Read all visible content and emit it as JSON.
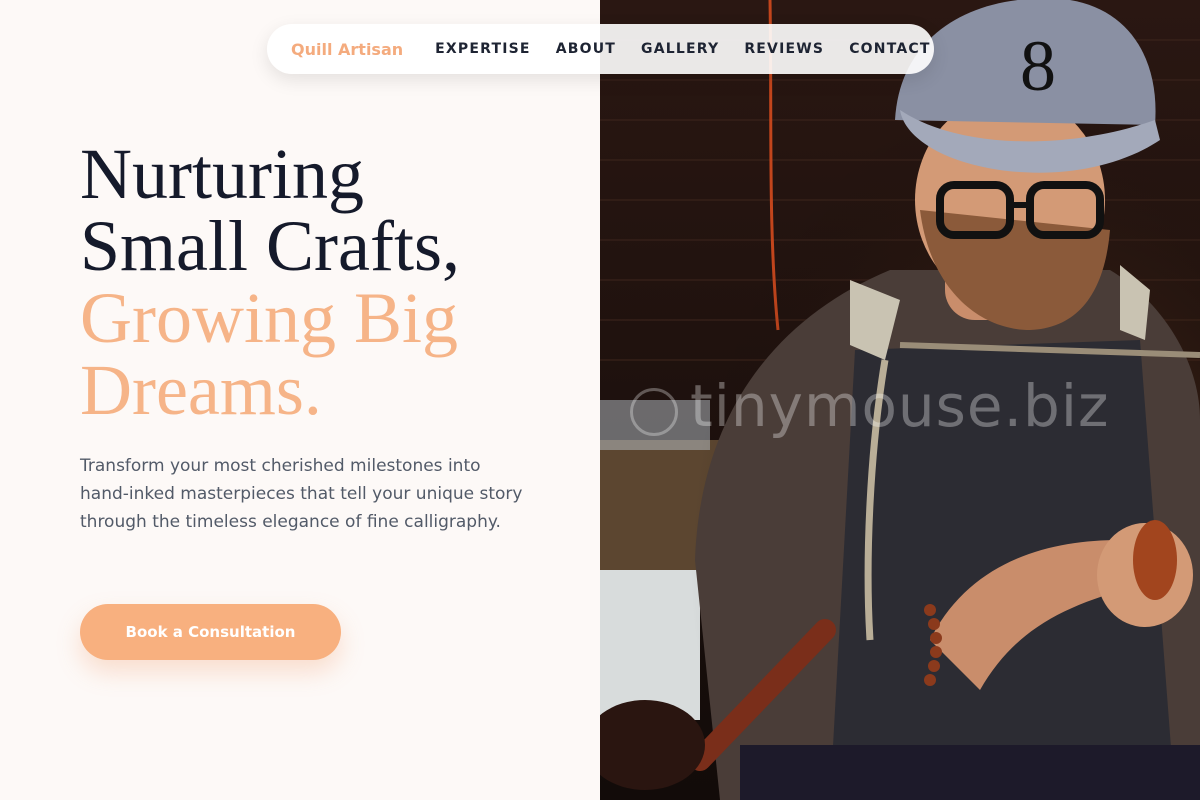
{
  "nav": {
    "brand": "Quill Artisan",
    "links": [
      "EXPERTISE",
      "ABOUT",
      "GALLERY",
      "REVIEWS",
      "CONTACT"
    ]
  },
  "hero": {
    "title_lines": [
      "Nurturing",
      "Small Crafts,"
    ],
    "accent_lines": [
      "Growing Big",
      "Dreams."
    ],
    "description": "Transform your most cherished milestones into hand-inked masterpieces that tell your unique story through the timeless elegance of fine calligraphy.",
    "cta_label": "Book a Consultation"
  },
  "photo": {
    "watermark": "tinymouse.biz"
  },
  "colors": {
    "accent": "#f6b488",
    "heading": "#151a2b",
    "body_text": "#525a68",
    "background": "#fdf9f7"
  }
}
